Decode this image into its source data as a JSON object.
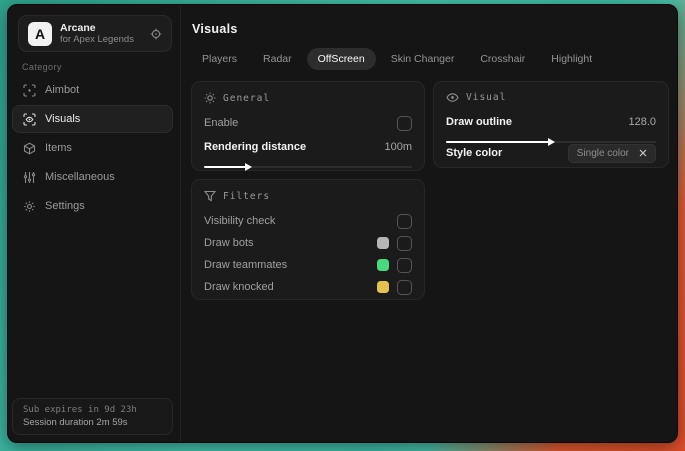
{
  "app": {
    "logo_letter": "A",
    "name": "Arcane",
    "subtitle": "for Apex Legends"
  },
  "sidebar": {
    "category_label": "Category",
    "items": [
      {
        "label": "Aimbot"
      },
      {
        "label": "Visuals"
      },
      {
        "label": "Items"
      },
      {
        "label": "Miscellaneous"
      },
      {
        "label": "Settings"
      }
    ],
    "footer": {
      "sub_expires": "Sub expires in 9d 23h",
      "session_duration": "Session duration 2m 59s"
    }
  },
  "main": {
    "title": "Visuals",
    "tabs": [
      {
        "label": "Players"
      },
      {
        "label": "Radar"
      },
      {
        "label": "OffScreen"
      },
      {
        "label": "Skin Changer"
      },
      {
        "label": "Crosshair"
      },
      {
        "label": "Highlight"
      }
    ],
    "selected_tab": "OffScreen"
  },
  "general_card": {
    "title": "General",
    "enable_label": "Enable",
    "rendering_distance_label": "Rendering distance",
    "rendering_distance_value": "100m",
    "rendering_distance_percent": "21%"
  },
  "visual_card": {
    "title": "Visual",
    "draw_outline_label": "Draw outline",
    "draw_outline_value": "128.0",
    "draw_outline_percent": "50%",
    "style_color_label": "Style color",
    "style_color_value": "Single color"
  },
  "filters_card": {
    "title": "Filters",
    "rows": [
      {
        "label": "Visibility check"
      },
      {
        "label": "Draw bots",
        "swatch": "#b5b5b5"
      },
      {
        "label": "Draw teammates",
        "swatch": "#4bd97e"
      },
      {
        "label": "Draw knocked",
        "swatch": "#e3c24f"
      }
    ]
  },
  "colors": {
    "accent_teal": "#3fbca6",
    "accent_orange": "#e0512e"
  }
}
